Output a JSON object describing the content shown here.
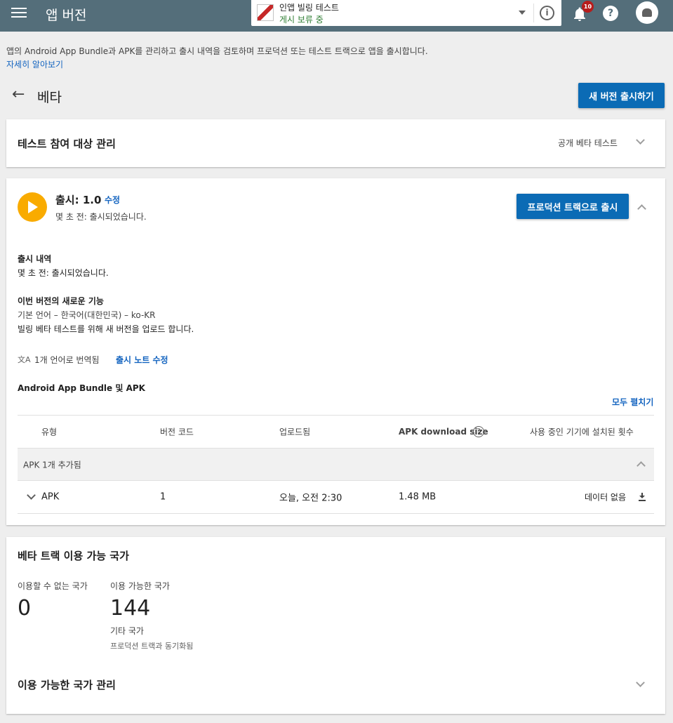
{
  "header": {
    "title": "앱 버전",
    "app_name": "인앱 빌링 테스트",
    "app_status": "게시 보류 중",
    "notification_count": "10",
    "help_glyph": "?",
    "info_glyph": "i"
  },
  "intro": {
    "description": "앱의 Android App Bundle과 APK를 관리하고 출시 내역을 검토하며 프로덕션 또는 테스트 트랙으로 앱을 출시합니다.",
    "learn_more": "자세히 알아보기"
  },
  "page": {
    "back_icon": "←",
    "title": "베타",
    "new_release_button": "새 버전 출시하기"
  },
  "testers": {
    "title": "테스트 참여 대상 관리",
    "mode": "공개 베타 테스트"
  },
  "release": {
    "title": "출시: 1.0",
    "edit": "수정",
    "subtitle": "몇 초 전: 출시되었습니다.",
    "promote_button": "프로덕션 트랙으로 출시",
    "history_title": "출시 내역",
    "history_text": "몇 초 전: 출시되었습니다.",
    "whats_new_title": "이번 버전의 새로운 기능",
    "language": "기본 언어 – 한국어(대한민국) – ko-KR",
    "notes": "빌링 베타 테스트를 위해 새 버전을 업로드 합니다.",
    "translate_icon": "文A",
    "translated": "1개 언어로 번역됨",
    "edit_notes": "출시 노트 수정",
    "bundles_title": "Android App Bundle 및 APK",
    "expand_all": "모두 펼치기"
  },
  "table": {
    "headers": {
      "type": "유형",
      "version_code": "버전 코드",
      "uploaded": "업로드됨",
      "download_size": "APK download size",
      "installs": "사용 중인 기기에 설치된 횟수"
    },
    "group_label": "APK 1개 추가됨",
    "rows": [
      {
        "type": "APK",
        "version_code": "1",
        "uploaded": "오늘, 오전 2:30",
        "size": "1.48 MB",
        "installs": "데이터 없음"
      }
    ]
  },
  "countries": {
    "title": "베타 트랙 이용 가능 국가",
    "unavailable_label": "이용할 수 없는 국가",
    "unavailable_count": "0",
    "available_label": "이용 가능한 국가",
    "available_count": "144",
    "other_label": "기타 국가",
    "synced_label": "프로덕션 트랙과 동기화됨",
    "manage": "이용 가능한 국가 관리"
  },
  "colors": {
    "topbar": "#546e7a",
    "primary_button": "#0b6bb5",
    "link": "#1565c0",
    "status_green": "#2e7d32",
    "release_icon": "#f9ab00",
    "badge": "#b71c1c"
  }
}
